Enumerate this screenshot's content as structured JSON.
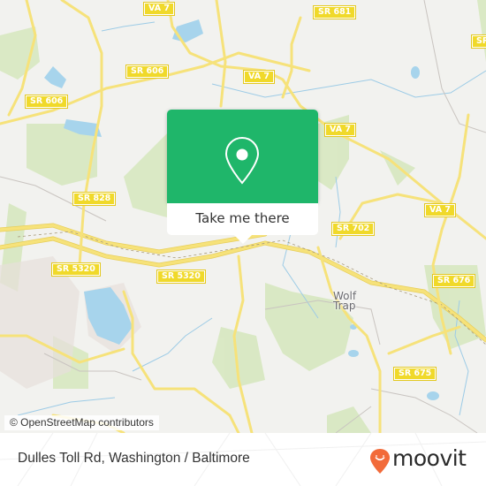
{
  "map": {
    "road_shields": [
      {
        "id": "va7-top",
        "label": "VA 7"
      },
      {
        "id": "sr681",
        "label": "SR 681"
      },
      {
        "id": "sr606-a",
        "label": "SR 606"
      },
      {
        "id": "sr606-b",
        "label": "SR 606"
      },
      {
        "id": "va7-mid",
        "label": "VA 7"
      },
      {
        "id": "va7-right",
        "label": "VA 7"
      },
      {
        "id": "va7-far",
        "label": "VA 7"
      },
      {
        "id": "sr828",
        "label": "SR 828"
      },
      {
        "id": "sr702",
        "label": "SR 702"
      },
      {
        "id": "sr5320-a",
        "label": "SR 5320"
      },
      {
        "id": "sr5320-b",
        "label": "SR 5320"
      },
      {
        "id": "sr676",
        "label": "SR 676"
      },
      {
        "id": "sr675",
        "label": "SR 675"
      },
      {
        "id": "sr-partial-right",
        "label": "SR"
      }
    ],
    "place_labels": [
      {
        "id": "wolf-trap",
        "line1": "Wolf",
        "line2": "Trap"
      }
    ],
    "attribution": "© OpenStreetMap contributors",
    "colors": {
      "land": "#f2f2ef",
      "park": "#d7e8c0",
      "water": "#a7d4ec",
      "road": "#f6e27a",
      "shield": "#f0d92a"
    }
  },
  "popup": {
    "icon": "map-pin-icon",
    "action_label": "Take me there",
    "color": "#1fb66a"
  },
  "footer": {
    "title": "Dulles Toll Rd, Washington / Baltimore",
    "brand": "moovit",
    "brand_color": "#f26b3a"
  }
}
